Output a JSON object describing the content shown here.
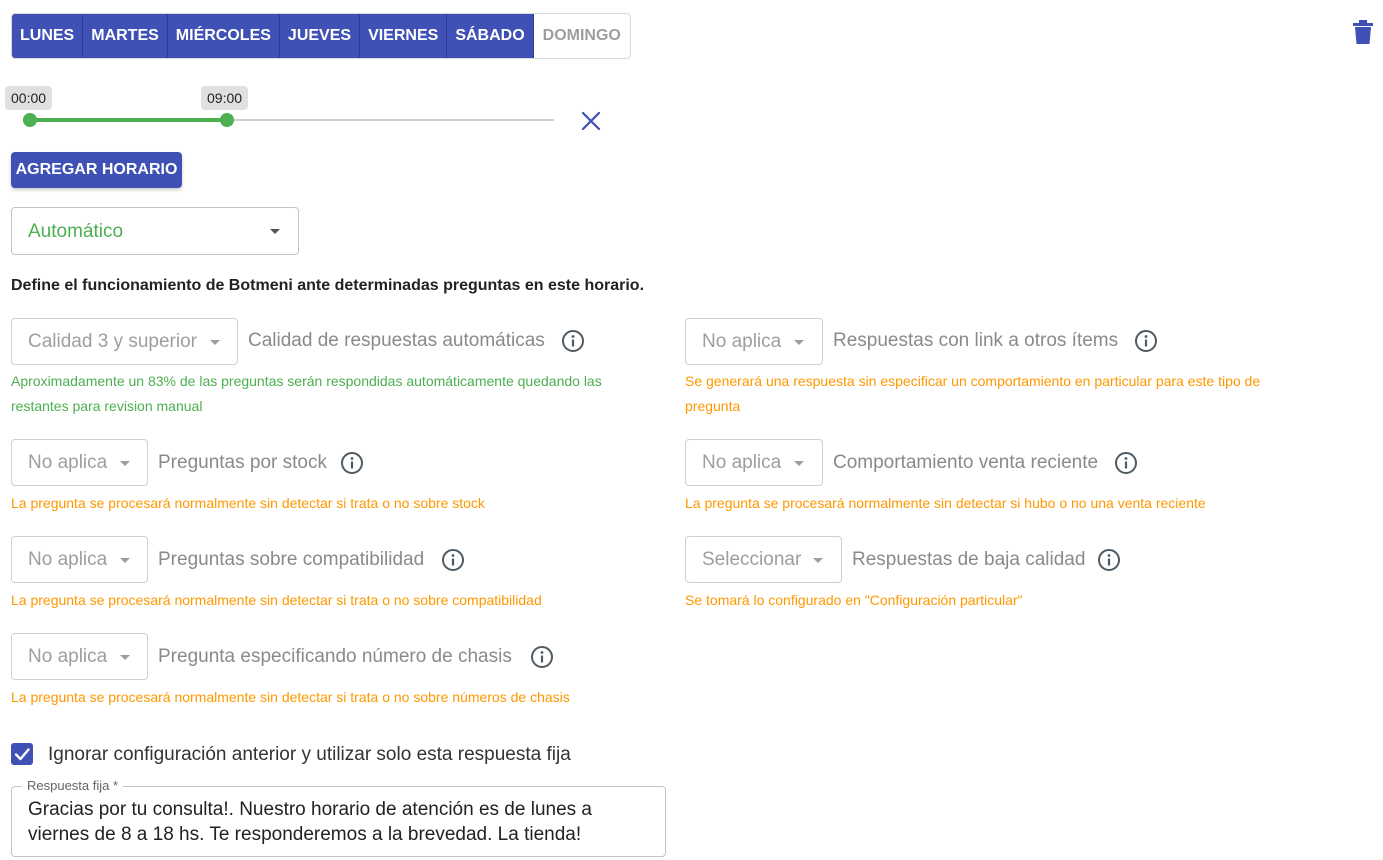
{
  "days": {
    "lunes": "LUNES",
    "martes": "MARTES",
    "miercoles": "MIÉRCOLES",
    "jueves": "JUEVES",
    "viernes": "VIERNES",
    "sabado": "SÁBADO",
    "domingo": "DOMINGO"
  },
  "range": {
    "start": "00:00",
    "end": "09:00"
  },
  "add_button": "AGREGAR HORARIO",
  "mode_select": {
    "value": "Automático"
  },
  "description": "Define el funcionamiento de Botmeni ante determinadas preguntas en este horario.",
  "settings": {
    "calidad": {
      "value": "Calidad 3 y superior",
      "label": "Calidad de respuestas automáticas",
      "hint_line1": "Aproximadamente un 83% de las preguntas serán respondidas automáticamente quedando las",
      "hint_line2": "restantes para revision manual"
    },
    "link": {
      "value": "No aplica",
      "label": "Respuestas con link a otros ítems",
      "hint_line1": "Se generará una respuesta sin especificar un comportamiento en particular para este tipo de",
      "hint_line2": "pregunta"
    },
    "stock": {
      "value": "No aplica",
      "label": "Preguntas por stock",
      "hint": "La pregunta se procesará normalmente sin detectar si trata o no sobre stock"
    },
    "venta": {
      "value": "No aplica",
      "label": "Comportamiento venta reciente",
      "hint": "La pregunta se procesará normalmente sin detectar si hubo o no una venta reciente"
    },
    "compat": {
      "value": "No aplica",
      "label": "Preguntas sobre compatibilidad",
      "hint": "La pregunta se procesará normalmente sin detectar si trata o no sobre compatibilidad"
    },
    "baja": {
      "value": "Seleccionar",
      "label": "Respuestas de baja calidad",
      "hint": "Se tomará lo configurado en \"Configuración particular\""
    },
    "chasis": {
      "value": "No aplica",
      "label": "Pregunta especificando número de chasis",
      "hint": "La pregunta se procesará normalmente sin detectar si trata o no sobre números de chasis"
    }
  },
  "ignore_checkbox": {
    "label": "Ignorar configuración anterior y utilizar solo esta respuesta fija",
    "checked": true
  },
  "fixed_response": {
    "legend": "Respuesta fija *",
    "value": "Gracias por tu consulta!. Nuestro horario de atención es de lunes a viernes de 8 a 18 hs. Te responderemos a la brevedad. La tienda!"
  },
  "colors": {
    "primary": "#3f51b5",
    "green": "#4caf50",
    "orange": "#ff9800"
  }
}
